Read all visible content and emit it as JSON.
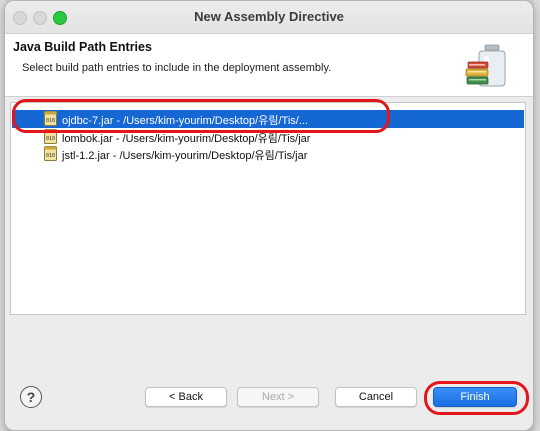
{
  "window": {
    "title": "New Assembly Directive"
  },
  "header": {
    "title": "Java Build Path Entries",
    "description": "Select build path entries to include in the deployment assembly.",
    "icon": "jar-stack-wizard-icon"
  },
  "entries": [
    {
      "label": "ojdbc-7.jar - /Users/kim-yourim/Desktop/유림/Tis/...",
      "selected": true
    },
    {
      "label": "lombok.jar - /Users/kim-yourim/Desktop/유림/Tis/jar",
      "selected": false
    },
    {
      "label": "jstl-1.2.jar - /Users/kim-yourim/Desktop/유림/Tis/jar",
      "selected": false
    }
  ],
  "buttons": {
    "help": "?",
    "back": "< Back",
    "next": "Next >",
    "cancel": "Cancel",
    "finish": "Finish"
  },
  "colors": {
    "selection": "#1567d3",
    "annotation": "#e4161b",
    "primary_button": "#1a6fe3"
  }
}
